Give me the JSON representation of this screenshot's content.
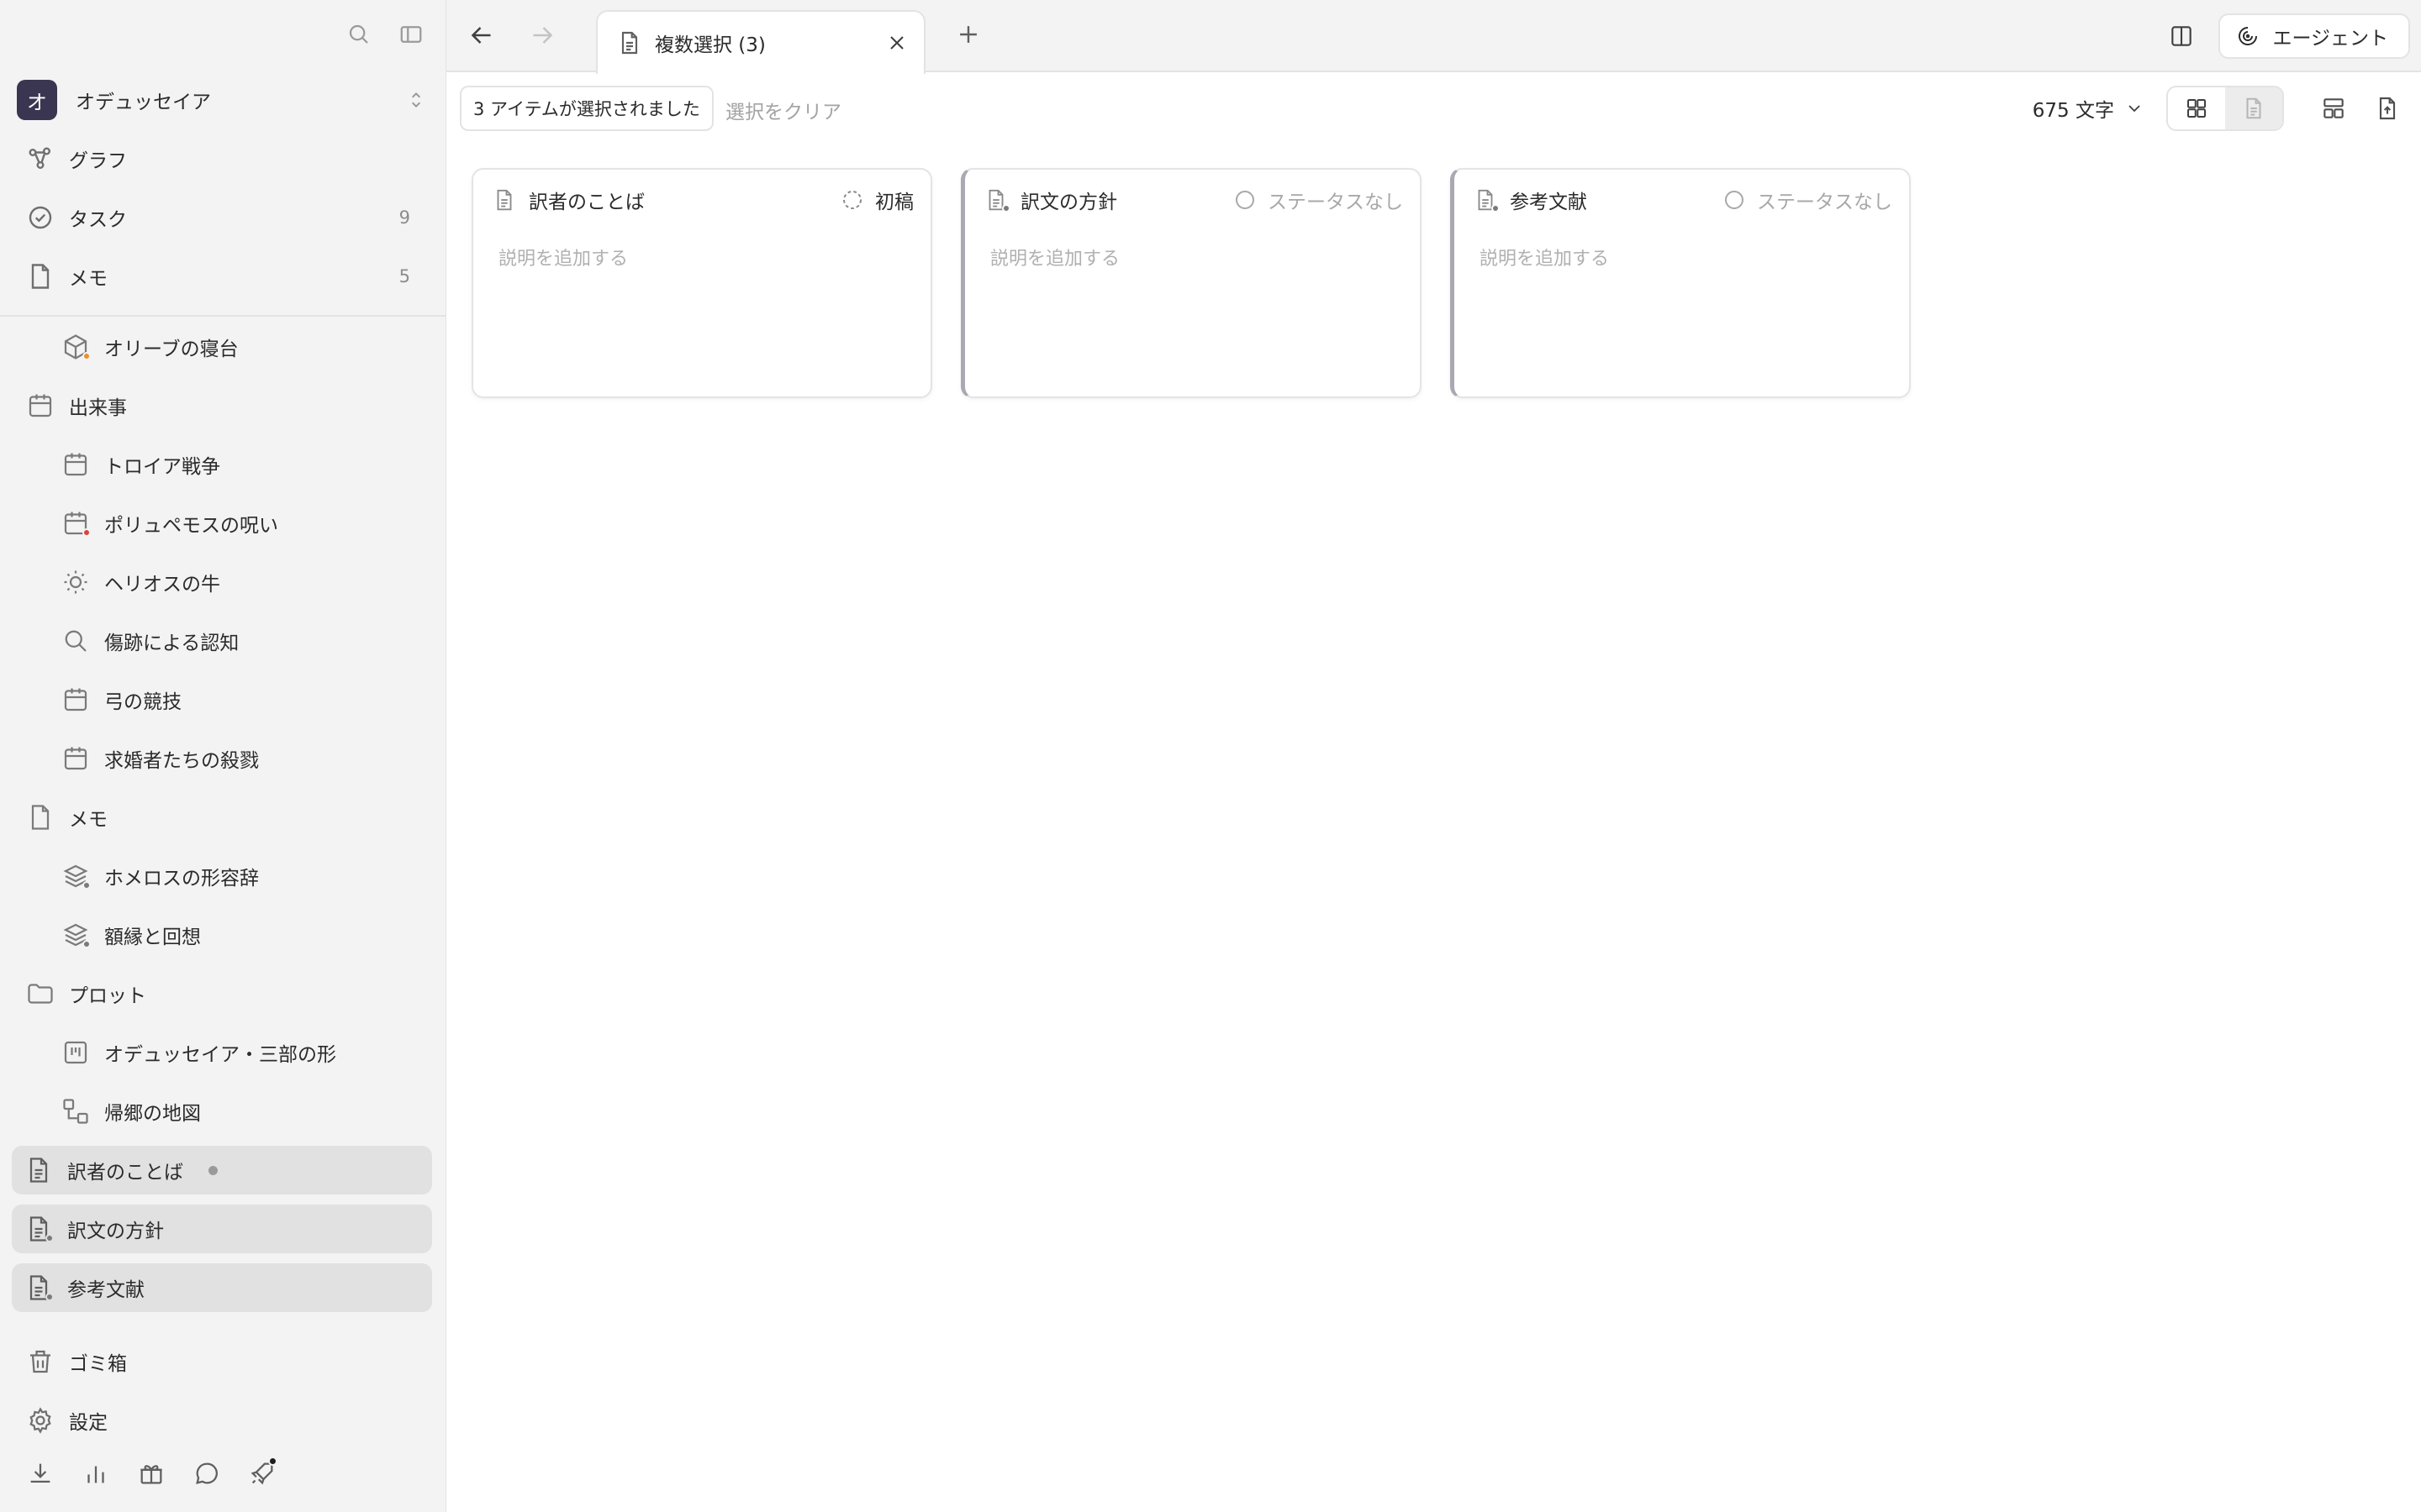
{
  "workspace": {
    "initial": "オ",
    "name": "オデュッセイア"
  },
  "sidebar": {
    "top": [
      {
        "label": "グラフ",
        "icon": "graph-icon",
        "count": ""
      },
      {
        "label": "タスク",
        "icon": "task-check-icon",
        "count": "9"
      },
      {
        "label": "メモ",
        "icon": "memo-page-icon",
        "count": "5"
      }
    ],
    "tree": [
      {
        "label": "オリーブの寝台",
        "icon": "cube-icon",
        "sub": true
      },
      {
        "label": "出来事",
        "icon": "calendar-icon",
        "sub": false
      },
      {
        "label": "トロイア戦争",
        "icon": "calendar-icon",
        "sub": true
      },
      {
        "label": "ポリュペモスの呪い",
        "icon": "calendar-icon",
        "sub": true
      },
      {
        "label": "ヘリオスの牛",
        "icon": "sun-icon",
        "sub": true
      },
      {
        "label": "傷跡による認知",
        "icon": "search-icon",
        "sub": true
      },
      {
        "label": "弓の競技",
        "icon": "calendar-icon",
        "sub": true
      },
      {
        "label": "求婚者たちの殺戮",
        "icon": "calendar-icon",
        "sub": true
      },
      {
        "label": "メモ",
        "icon": "memo-page-icon",
        "sub": false
      },
      {
        "label": "ホメロスの形容辞",
        "icon": "layers-icon",
        "sub": true
      },
      {
        "label": "額縁と回想",
        "icon": "layers-icon",
        "sub": true
      },
      {
        "label": "プロット",
        "icon": "folder-icon",
        "sub": false
      },
      {
        "label": "オデュッセイア・三部の形",
        "icon": "board-icon",
        "sub": true
      },
      {
        "label": "帰郷の地図",
        "icon": "diagram-icon",
        "sub": true
      }
    ],
    "selected": [
      {
        "label": "訳者のことば"
      },
      {
        "label": "訳文の方針"
      },
      {
        "label": "参考文献"
      }
    ],
    "bottom": [
      {
        "label": "ゴミ箱",
        "icon": "trash-icon"
      },
      {
        "label": "設定",
        "icon": "gear-icon"
      }
    ]
  },
  "tabs": [
    {
      "label": "複数選択 (3)"
    }
  ],
  "header": {
    "agent_label": "エージェント"
  },
  "toolbar": {
    "selection_text": "3 アイテムが選択されました",
    "clear_label": "選択をクリア",
    "word_count": "675 文字"
  },
  "cards": [
    {
      "title": "訳者のことば",
      "status": "初稿",
      "desc_placeholder": "説明を追加する"
    },
    {
      "title": "訳文の方針",
      "status": "ステータスなし",
      "desc_placeholder": "説明を追加する"
    },
    {
      "title": "参考文献",
      "status": "ステータスなし",
      "desc_placeholder": "説明を追加する"
    }
  ],
  "colors": {
    "accent_dot_orange": "#e8912d",
    "accent_dot_red": "#d9453b",
    "avatar_bg": "#3a3550"
  }
}
